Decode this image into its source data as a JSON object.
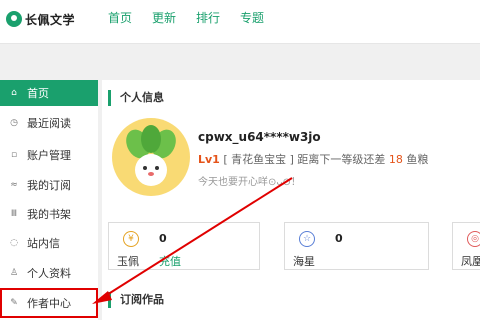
{
  "header": {
    "logo_text": "长佩文学",
    "nav": [
      "首页",
      "更新",
      "排行",
      "专题"
    ]
  },
  "sidebar": {
    "items": [
      {
        "label": "首页",
        "icon": "home-icon",
        "glyph": "⌂"
      },
      {
        "label": "最近阅读",
        "icon": "clock-icon",
        "glyph": "◷"
      },
      {
        "label": "账户管理",
        "icon": "account-icon",
        "glyph": "▫"
      },
      {
        "label": "我的订阅",
        "icon": "rss-icon",
        "glyph": "≈"
      },
      {
        "label": "我的书架",
        "icon": "bookshelf-icon",
        "glyph": "Ⅲ"
      },
      {
        "label": "站内信",
        "icon": "message-icon",
        "glyph": "◌"
      },
      {
        "label": "个人资料",
        "icon": "person-icon",
        "glyph": "♙"
      },
      {
        "label": "作者中心",
        "icon": "pencil-icon",
        "glyph": "✎"
      }
    ]
  },
  "profile": {
    "section_title": "个人信息",
    "username": "cpwx_u64****w3jo",
    "level": "Lv1",
    "level_title": "[ 青花鱼宝宝 ]",
    "next_level_prefix": "距离下一等级还差",
    "next_level_amount": "18",
    "next_level_unit": "鱼粮",
    "motto": "今天也要开心咩⊙ᴗ⊙！"
  },
  "stats": [
    {
      "icon": "yupei-icon",
      "glyph": "¥",
      "value": "0",
      "label": "玉佩",
      "link": "充值"
    },
    {
      "icon": "star-icon",
      "glyph": "☆",
      "value": "0",
      "label": "海星",
      "link": ""
    },
    {
      "icon": "fengling-icon",
      "glyph": "◎",
      "value": "",
      "label": "凤凰",
      "link": ""
    }
  ],
  "subscriptions": {
    "section_title": "订阅作品"
  },
  "colors": {
    "brand": "#1aa06d",
    "accent": "#e5541a",
    "annotation": "#e00000"
  }
}
